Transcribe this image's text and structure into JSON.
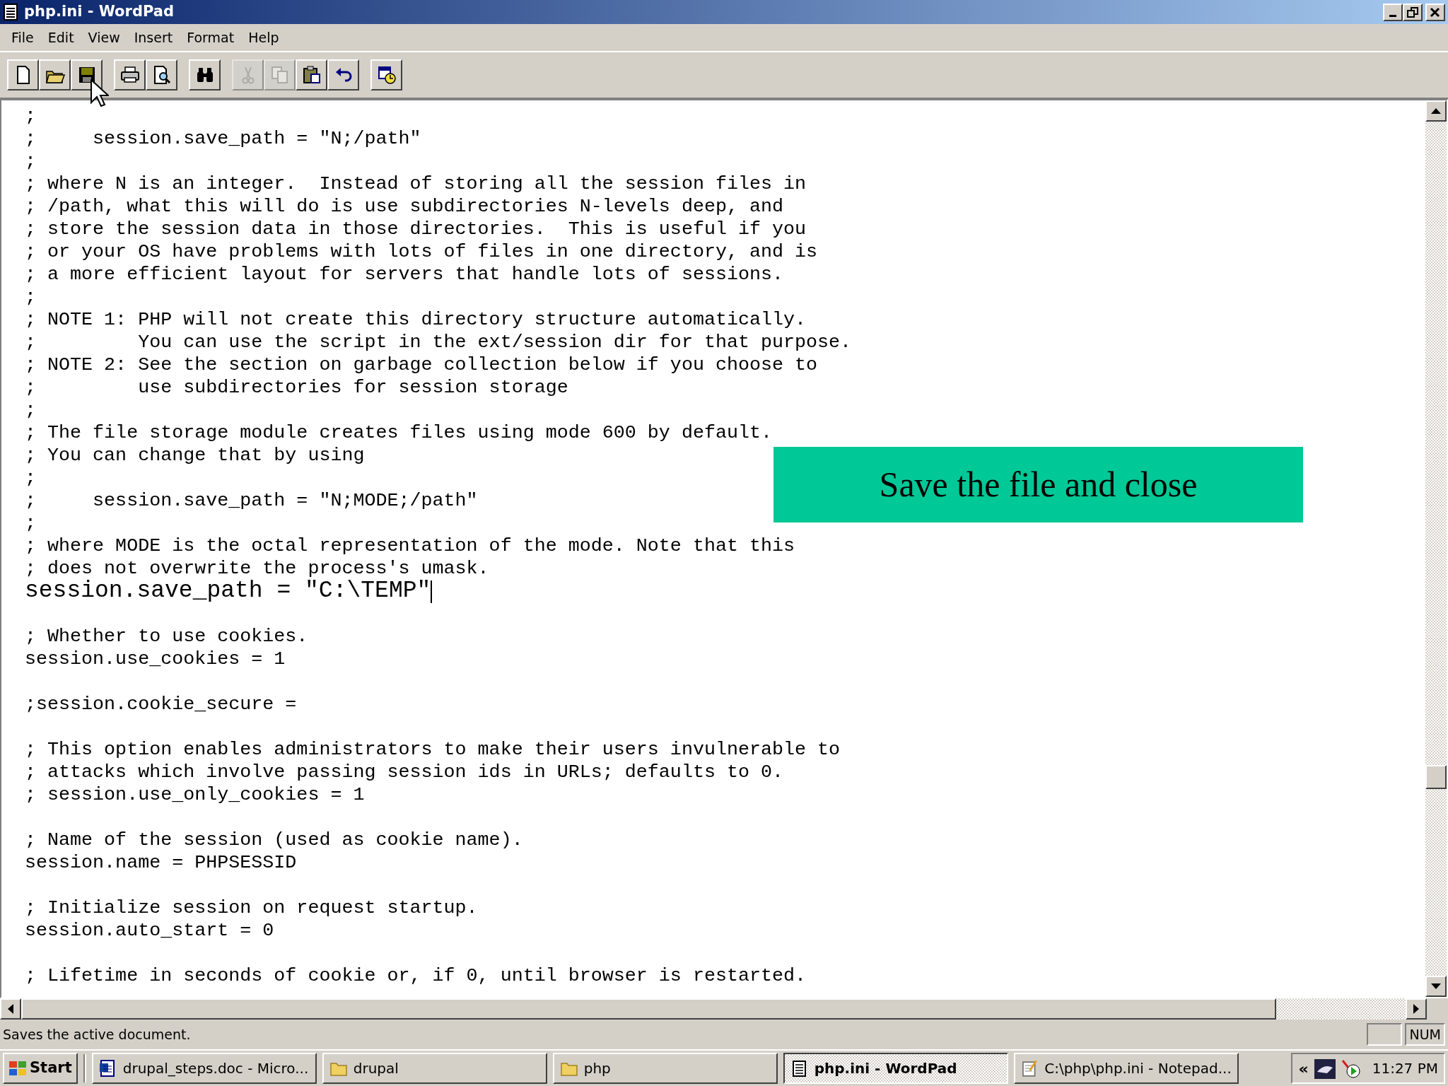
{
  "window": {
    "title": "php.ini - WordPad"
  },
  "menu": [
    "File",
    "Edit",
    "View",
    "Insert",
    "Format",
    "Help"
  ],
  "toolbar_groups": [
    [
      {
        "kind": "new",
        "disabled": false
      },
      {
        "kind": "open",
        "disabled": false
      },
      {
        "kind": "save",
        "disabled": false
      }
    ],
    [
      {
        "kind": "print",
        "disabled": false
      },
      {
        "kind": "preview",
        "disabled": false
      }
    ],
    [
      {
        "kind": "find",
        "disabled": false
      }
    ],
    [
      {
        "kind": "cut",
        "disabled": true
      },
      {
        "kind": "copy",
        "disabled": true
      },
      {
        "kind": "paste",
        "disabled": false
      },
      {
        "kind": "undo",
        "disabled": false
      }
    ],
    [
      {
        "kind": "datetime",
        "disabled": false
      }
    ]
  ],
  "document_lines": [
    {
      "kind": "text",
      "text": ";"
    },
    {
      "kind": "text",
      "text": ";     session.save_path = \"N;/path\""
    },
    {
      "kind": "text",
      "text": ";"
    },
    {
      "kind": "text",
      "text": "; where N is an integer.  Instead of storing all the session files in"
    },
    {
      "kind": "text",
      "text": "; /path, what this will do is use subdirectories N-levels deep, and"
    },
    {
      "kind": "text",
      "text": "; store the session data in those directories.  This is useful if you"
    },
    {
      "kind": "text",
      "text": "; or your OS have problems with lots of files in one directory, and is"
    },
    {
      "kind": "text",
      "text": "; a more efficient layout for servers that handle lots of sessions."
    },
    {
      "kind": "text",
      "text": ";"
    },
    {
      "kind": "text",
      "text": "; NOTE 1: PHP will not create this directory structure automatically."
    },
    {
      "kind": "text",
      "text": ";         You can use the script in the ext/session dir for that purpose."
    },
    {
      "kind": "text",
      "text": "; NOTE 2: See the section on garbage collection below if you choose to"
    },
    {
      "kind": "text",
      "text": ";         use subdirectories for session storage"
    },
    {
      "kind": "text",
      "text": ";"
    },
    {
      "kind": "text",
      "text": "; The file storage module creates files using mode 600 by default."
    },
    {
      "kind": "text",
      "text": "; You can change that by using"
    },
    {
      "kind": "text",
      "text": ";"
    },
    {
      "kind": "text",
      "text": ";     session.save_path = \"N;MODE;/path\""
    },
    {
      "kind": "text",
      "text": ";"
    },
    {
      "kind": "text",
      "text": "; where MODE is the octal representation of the mode. Note that this"
    },
    {
      "kind": "text",
      "text": "; does not overwrite the process's umask."
    },
    {
      "kind": "edited",
      "text": "session.save_path = \"C:\\TEMP\""
    },
    {
      "kind": "blank"
    },
    {
      "kind": "text",
      "text": "; Whether to use cookies."
    },
    {
      "kind": "text",
      "text": "session.use_cookies = 1"
    },
    {
      "kind": "blank"
    },
    {
      "kind": "text",
      "text": ";session.cookie_secure ="
    },
    {
      "kind": "blank"
    },
    {
      "kind": "text",
      "text": "; This option enables administrators to make their users invulnerable to"
    },
    {
      "kind": "text",
      "text": "; attacks which involve passing session ids in URLs; defaults to 0."
    },
    {
      "kind": "text",
      "text": "; session.use_only_cookies = 1"
    },
    {
      "kind": "blank"
    },
    {
      "kind": "text",
      "text": "; Name of the session (used as cookie name)."
    },
    {
      "kind": "text",
      "text": "session.name = PHPSESSID"
    },
    {
      "kind": "blank"
    },
    {
      "kind": "text",
      "text": "; Initialize session on request startup."
    },
    {
      "kind": "text",
      "text": "session.auto_start = 0"
    },
    {
      "kind": "blank"
    },
    {
      "kind": "text",
      "text": "; Lifetime in seconds of cookie or, if 0, until browser is restarted."
    }
  ],
  "overlay_caption": "Save the file and close",
  "status_bar": {
    "text": "Saves the active document.",
    "indicators": [
      "NUM"
    ]
  },
  "taskbar": {
    "start": "Start",
    "items": [
      {
        "kind": "word",
        "label": "drupal_steps.doc - Micro...",
        "selected": false
      },
      {
        "kind": "folder",
        "label": "drupal",
        "selected": false
      },
      {
        "kind": "folder",
        "label": "php",
        "selected": false
      },
      {
        "kind": "wordpad",
        "label": "php.ini - WordPad",
        "selected": true
      },
      {
        "kind": "notepad",
        "label": "C:\\php\\php.ini - Notepad...",
        "selected": false
      }
    ],
    "tray_toggle": "«",
    "clock": "11:27 PM"
  }
}
